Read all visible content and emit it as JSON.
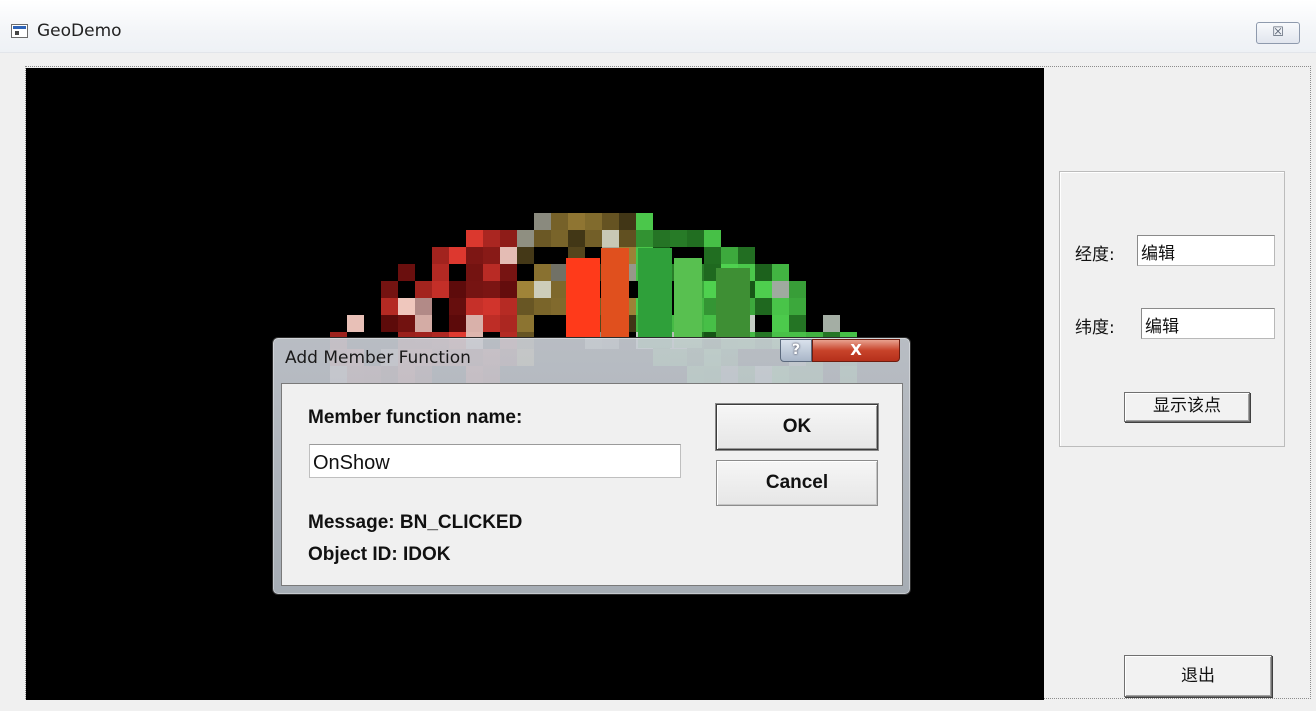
{
  "window": {
    "title": "GeoDemo",
    "close_glyph": "☒",
    "icon": "app-window-icon"
  },
  "side_panel": {
    "longitude_label": "经度:",
    "longitude_value": "编辑",
    "latitude_label": "纬度:",
    "latitude_value": "编辑",
    "show_point_button": "显示该点",
    "exit_button": "退出"
  },
  "dialog": {
    "title": "Add Member Function",
    "help_glyph": "?",
    "close_glyph": "X",
    "name_label": "Member function name:",
    "name_value": "OnShow",
    "ok_button": "OK",
    "cancel_button": "Cancel",
    "message_text": "Message: BN_CLICKED",
    "object_id_text": "Object ID: IDOK",
    "colors": {
      "close": "#c8432a",
      "help": "#a9b6c8"
    }
  }
}
